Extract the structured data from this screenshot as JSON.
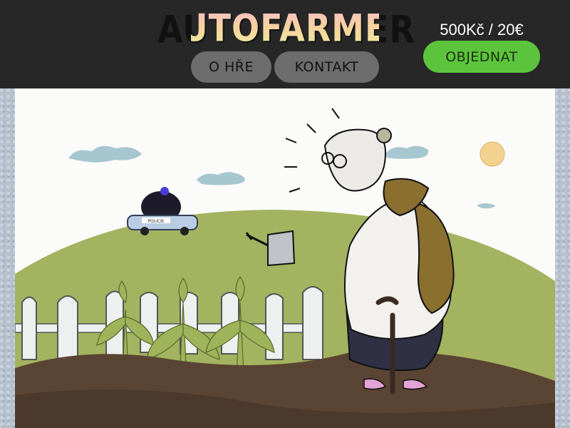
{
  "header": {
    "logo_text": "AUTOFARMER",
    "nav": {
      "about_label": "O HŘE",
      "contact_label": "KONTAKT"
    },
    "price": "500Kč / 20€",
    "order_label": "OBJEDNAT"
  },
  "illustration": {
    "police_car_label": "POLICIE"
  },
  "colors": {
    "header_bg": "#272727",
    "nav_button_bg": "#6d6d6d",
    "order_button_bg": "#5cc43c",
    "hill": "#9fb25a",
    "soil": "#5a4433"
  },
  "icons": [
    "logo",
    "police-car",
    "watering-can",
    "cane"
  ]
}
